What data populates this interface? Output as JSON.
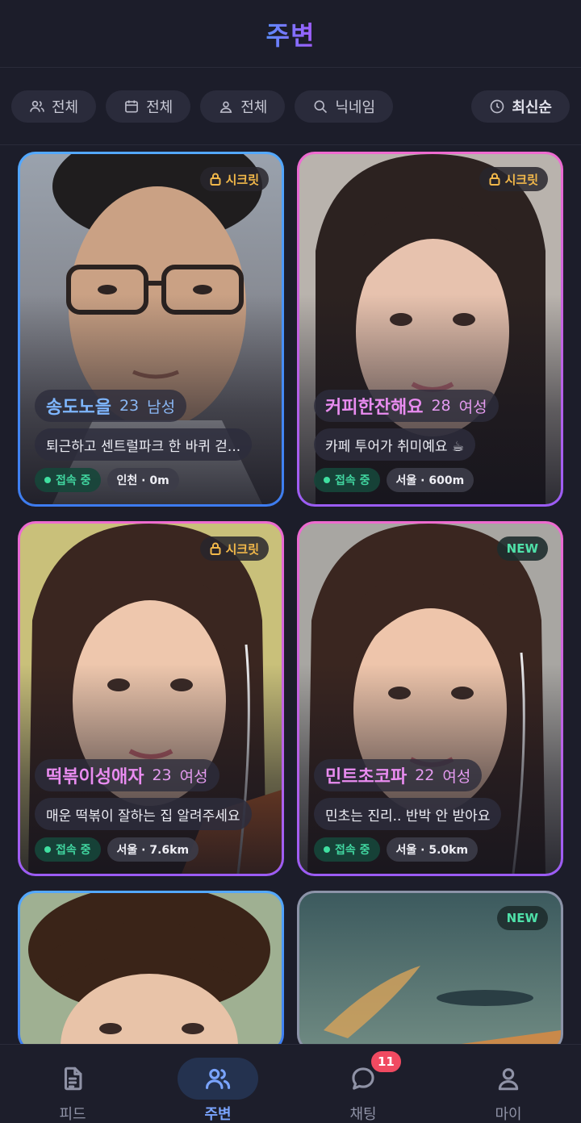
{
  "header": {
    "title": "주변"
  },
  "filters": {
    "gender": {
      "label": "전체",
      "icon": "people-icon"
    },
    "age": {
      "label": "전체",
      "icon": "calendar-icon"
    },
    "region": {
      "label": "전체",
      "icon": "location-user-icon"
    },
    "search": {
      "label": "닉네임",
      "icon": "search-icon"
    },
    "sort": {
      "label": "최신순",
      "icon": "clock-icon"
    }
  },
  "cards": [
    {
      "type": "male",
      "badge": "시크릿",
      "name": "송도노을",
      "age": "23",
      "gender": "남성",
      "bio": "퇴근하고 센트럴파크 한 바퀴 걷...",
      "status": "접속 중",
      "location": "인천 · 0m"
    },
    {
      "type": "female",
      "badge": "시크릿",
      "name": "커피한잔해요",
      "age": "28",
      "gender": "여성",
      "bio": "카페 투어가 취미예요 ☕",
      "status": "접속 중",
      "location": "서울 · 600m"
    },
    {
      "type": "female",
      "badge": "시크릿",
      "name": "떡볶이성애자",
      "age": "23",
      "gender": "여성",
      "bio": "매운 떡볶이 잘하는 집 알려주세요",
      "status": "접속 중",
      "location": "서울 · 7.6km"
    },
    {
      "type": "female",
      "badge": "NEW",
      "name": "민트초코파",
      "age": "22",
      "gender": "여성",
      "bio": "민초는 진리.. 반박 안 받아요",
      "status": "접속 중",
      "location": "서울 · 5.0km"
    },
    {
      "type": "male",
      "badge": ""
    },
    {
      "type": "gray",
      "badge": "NEW"
    }
  ],
  "nav": {
    "feed": "피드",
    "nearby": "주변",
    "chat": "채팅",
    "chat_badge": "11",
    "my": "마이"
  },
  "colors": {
    "accent": "#7aa4ff",
    "male": "#53a8ff",
    "female": "#ee6bd0",
    "online": "#3fe0a0",
    "secret": "#f2b84a"
  }
}
